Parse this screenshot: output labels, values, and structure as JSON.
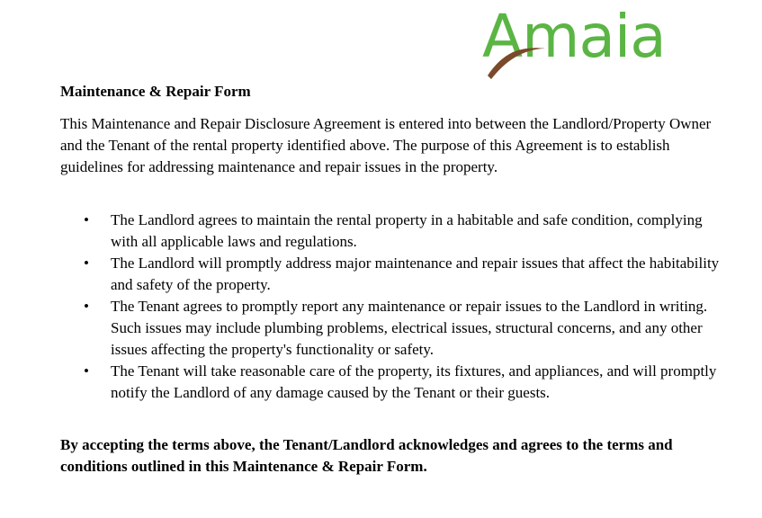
{
  "brand": {
    "logo_text": "Amaia",
    "logo_color": "#5bb544",
    "swoosh_color": "#7a4a2a"
  },
  "document": {
    "title": "Maintenance & Repair Form",
    "intro": "This Maintenance and Repair Disclosure Agreement is entered into between the Landlord/Property Owner and the Tenant of the rental property identified above. The purpose of this Agreement is to establish guidelines for addressing maintenance and repair issues in the property.",
    "bullet_symbol": "•",
    "bullets": [
      "The Landlord agrees to maintain the rental property in a habitable and safe condition, complying with all applicable laws and regulations.",
      "The Landlord will promptly address major maintenance and repair issues that affect the habitability and safety of the property.",
      "The Tenant agrees to promptly report any maintenance or repair issues to the Landlord in writing. Such issues may include plumbing problems, electrical issues, structural concerns, and any other issues affecting the property's functionality or safety.",
      "The Tenant will take reasonable care of the property, its fixtures, and appliances, and will promptly notify the Landlord of any damage caused by the Tenant or their guests."
    ],
    "closing": "By accepting the terms above, the Tenant/Landlord acknowledges and agrees to the terms and conditions outlined in this Maintenance & Repair Form."
  }
}
